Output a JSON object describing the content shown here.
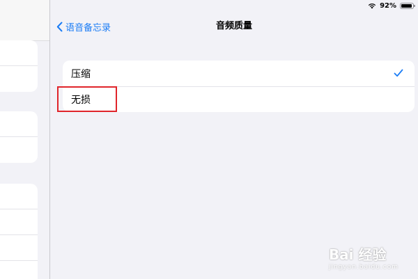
{
  "status_bar": {
    "battery_text": "92%",
    "battery_level": 0.92,
    "wifi_icon": "wifi-icon"
  },
  "nav": {
    "back_label": "语音备忘录",
    "title": "音频质量"
  },
  "options": [
    {
      "label": "压缩",
      "selected": true
    },
    {
      "label": "无损",
      "selected": false
    }
  ],
  "watermark": {
    "text": "Bai 经验",
    "sub": "jingyan.baidu.com"
  },
  "colors": {
    "accent": "#1a7cf5",
    "highlight": "#e0242a",
    "background": "#f2f2f7"
  }
}
